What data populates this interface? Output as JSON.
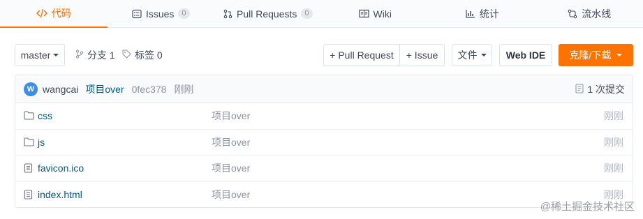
{
  "tabs": [
    {
      "label": "代码",
      "icon": "code-icon",
      "active": true
    },
    {
      "label": "Issues",
      "icon": "issues-icon",
      "badge": "0"
    },
    {
      "label": "Pull Requests",
      "icon": "pull-request-icon",
      "badge": "0"
    },
    {
      "label": "Wiki",
      "icon": "wiki-icon"
    },
    {
      "label": "统计",
      "icon": "stats-icon"
    },
    {
      "label": "流水线",
      "icon": "pipeline-icon"
    }
  ],
  "toolbar": {
    "branch": "master",
    "branches_label": "分支 1",
    "tags_label": "标签 0",
    "new_pr": "+ Pull Request",
    "new_issue": "+ Issue",
    "file_menu": "文件",
    "web_ide": "Web IDE",
    "clone": "克隆/下载"
  },
  "commit": {
    "avatar_letter": "W",
    "author": "wangcai",
    "message": "项目over",
    "hash": "0fec378",
    "time": "刚刚",
    "count": "1 次提交"
  },
  "files": [
    {
      "name": "css",
      "type": "folder",
      "message": "项目over",
      "time": "刚刚"
    },
    {
      "name": "js",
      "type": "folder",
      "message": "项目over",
      "time": "刚刚"
    },
    {
      "name": "favicon.ico",
      "type": "file",
      "message": "项目over",
      "time": "刚刚"
    },
    {
      "name": "index.html",
      "type": "file",
      "message": "项目over",
      "time": "刚刚"
    }
  ],
  "watermark": "@稀土掘金技术社区",
  "colors": {
    "accent": "#fe7300",
    "link": "#005980",
    "muted": "#8c92a4"
  }
}
